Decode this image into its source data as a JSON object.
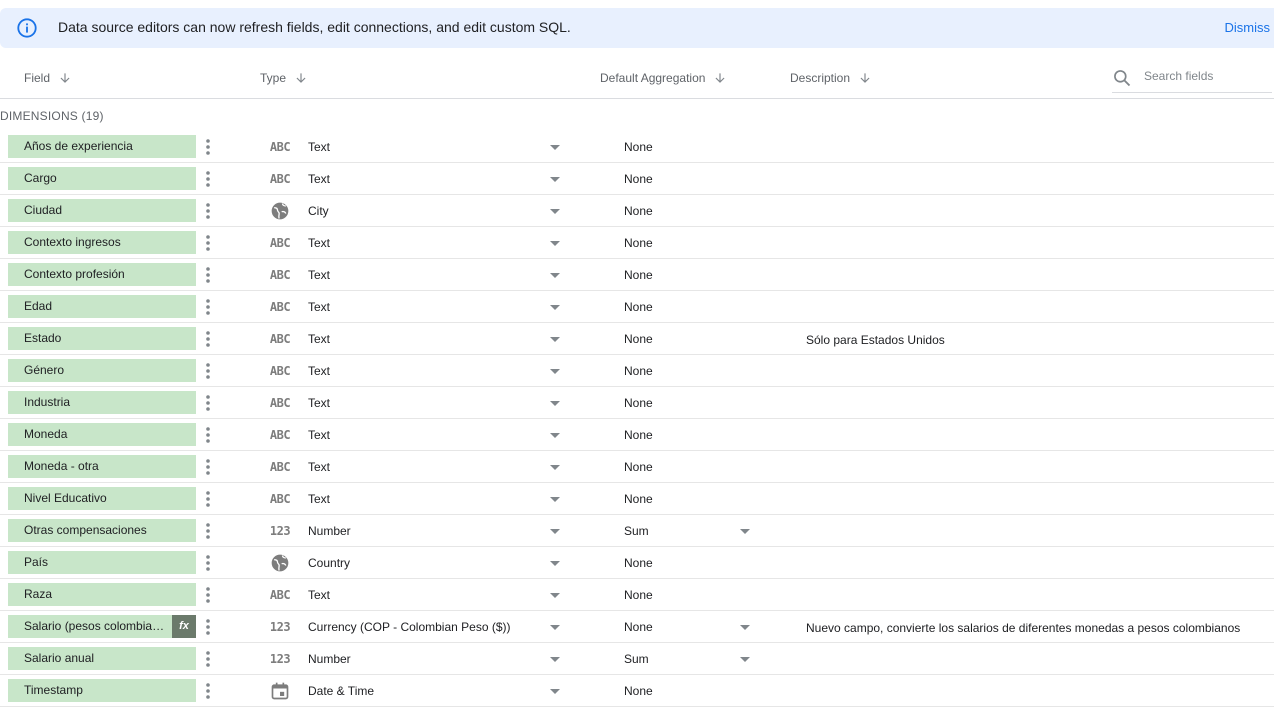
{
  "banner": {
    "message": "Data source editors can now refresh fields, edit connections, and edit custom SQL.",
    "dismiss_label": "Dismiss"
  },
  "columns": {
    "field": "Field",
    "type": "Type",
    "default_aggregation": "Default Aggregation",
    "description": "Description"
  },
  "search": {
    "placeholder": "Search fields",
    "value": ""
  },
  "section": {
    "title": "DIMENSIONS (19)"
  },
  "fields": [
    {
      "name": "Años de experiencia",
      "type_icon": "ABC",
      "type": "Text",
      "aggregation": "None",
      "description": "",
      "calculated": false,
      "agg_dropdown": false
    },
    {
      "name": "Cargo",
      "type_icon": "ABC",
      "type": "Text",
      "aggregation": "None",
      "description": "",
      "calculated": false,
      "agg_dropdown": false
    },
    {
      "name": "Ciudad",
      "type_icon": "globe",
      "type": "City",
      "aggregation": "None",
      "description": "",
      "calculated": false,
      "agg_dropdown": false
    },
    {
      "name": "Contexto ingresos",
      "type_icon": "ABC",
      "type": "Text",
      "aggregation": "None",
      "description": "",
      "calculated": false,
      "agg_dropdown": false
    },
    {
      "name": "Contexto profesión",
      "type_icon": "ABC",
      "type": "Text",
      "aggregation": "None",
      "description": "",
      "calculated": false,
      "agg_dropdown": false
    },
    {
      "name": "Edad",
      "type_icon": "ABC",
      "type": "Text",
      "aggregation": "None",
      "description": "",
      "calculated": false,
      "agg_dropdown": false
    },
    {
      "name": "Estado",
      "type_icon": "ABC",
      "type": "Text",
      "aggregation": "None",
      "description": "Sólo para Estados Unidos",
      "calculated": false,
      "agg_dropdown": false
    },
    {
      "name": "Género",
      "type_icon": "ABC",
      "type": "Text",
      "aggregation": "None",
      "description": "",
      "calculated": false,
      "agg_dropdown": false
    },
    {
      "name": "Industria",
      "type_icon": "ABC",
      "type": "Text",
      "aggregation": "None",
      "description": "",
      "calculated": false,
      "agg_dropdown": false
    },
    {
      "name": "Moneda",
      "type_icon": "ABC",
      "type": "Text",
      "aggregation": "None",
      "description": "",
      "calculated": false,
      "agg_dropdown": false
    },
    {
      "name": "Moneda - otra",
      "type_icon": "ABC",
      "type": "Text",
      "aggregation": "None",
      "description": "",
      "calculated": false,
      "agg_dropdown": false
    },
    {
      "name": "Nivel Educativo",
      "type_icon": "ABC",
      "type": "Text",
      "aggregation": "None",
      "description": "",
      "calculated": false,
      "agg_dropdown": false
    },
    {
      "name": "Otras compensaciones",
      "type_icon": "123",
      "type": "Number",
      "aggregation": "Sum",
      "description": "",
      "calculated": false,
      "agg_dropdown": true
    },
    {
      "name": "País",
      "type_icon": "globe",
      "type": "Country",
      "aggregation": "None",
      "description": "",
      "calculated": false,
      "agg_dropdown": false
    },
    {
      "name": "Raza",
      "type_icon": "ABC",
      "type": "Text",
      "aggregation": "None",
      "description": "",
      "calculated": false,
      "agg_dropdown": false
    },
    {
      "name": "Salario (pesos colombianos)",
      "type_icon": "123",
      "type": "Currency (COP - Colombian Peso ($))",
      "aggregation": "None",
      "description": "Nuevo campo, convierte los salarios de diferentes monedas a pesos colombianos",
      "calculated": true,
      "calc_badge": "fx",
      "agg_dropdown": true
    },
    {
      "name": "Salario anual",
      "type_icon": "123",
      "type": "Number",
      "aggregation": "Sum",
      "description": "",
      "calculated": false,
      "agg_dropdown": true
    },
    {
      "name": "Timestamp",
      "type_icon": "calendar",
      "type": "Date & Time",
      "aggregation": "None",
      "description": "",
      "calculated": false,
      "agg_dropdown": false
    }
  ],
  "colors": {
    "banner_bg": "#e8f0fe",
    "accent": "#1a73e8",
    "dimension_chip": "#c8e6c9",
    "fx_badge": "#6b7a6b"
  }
}
